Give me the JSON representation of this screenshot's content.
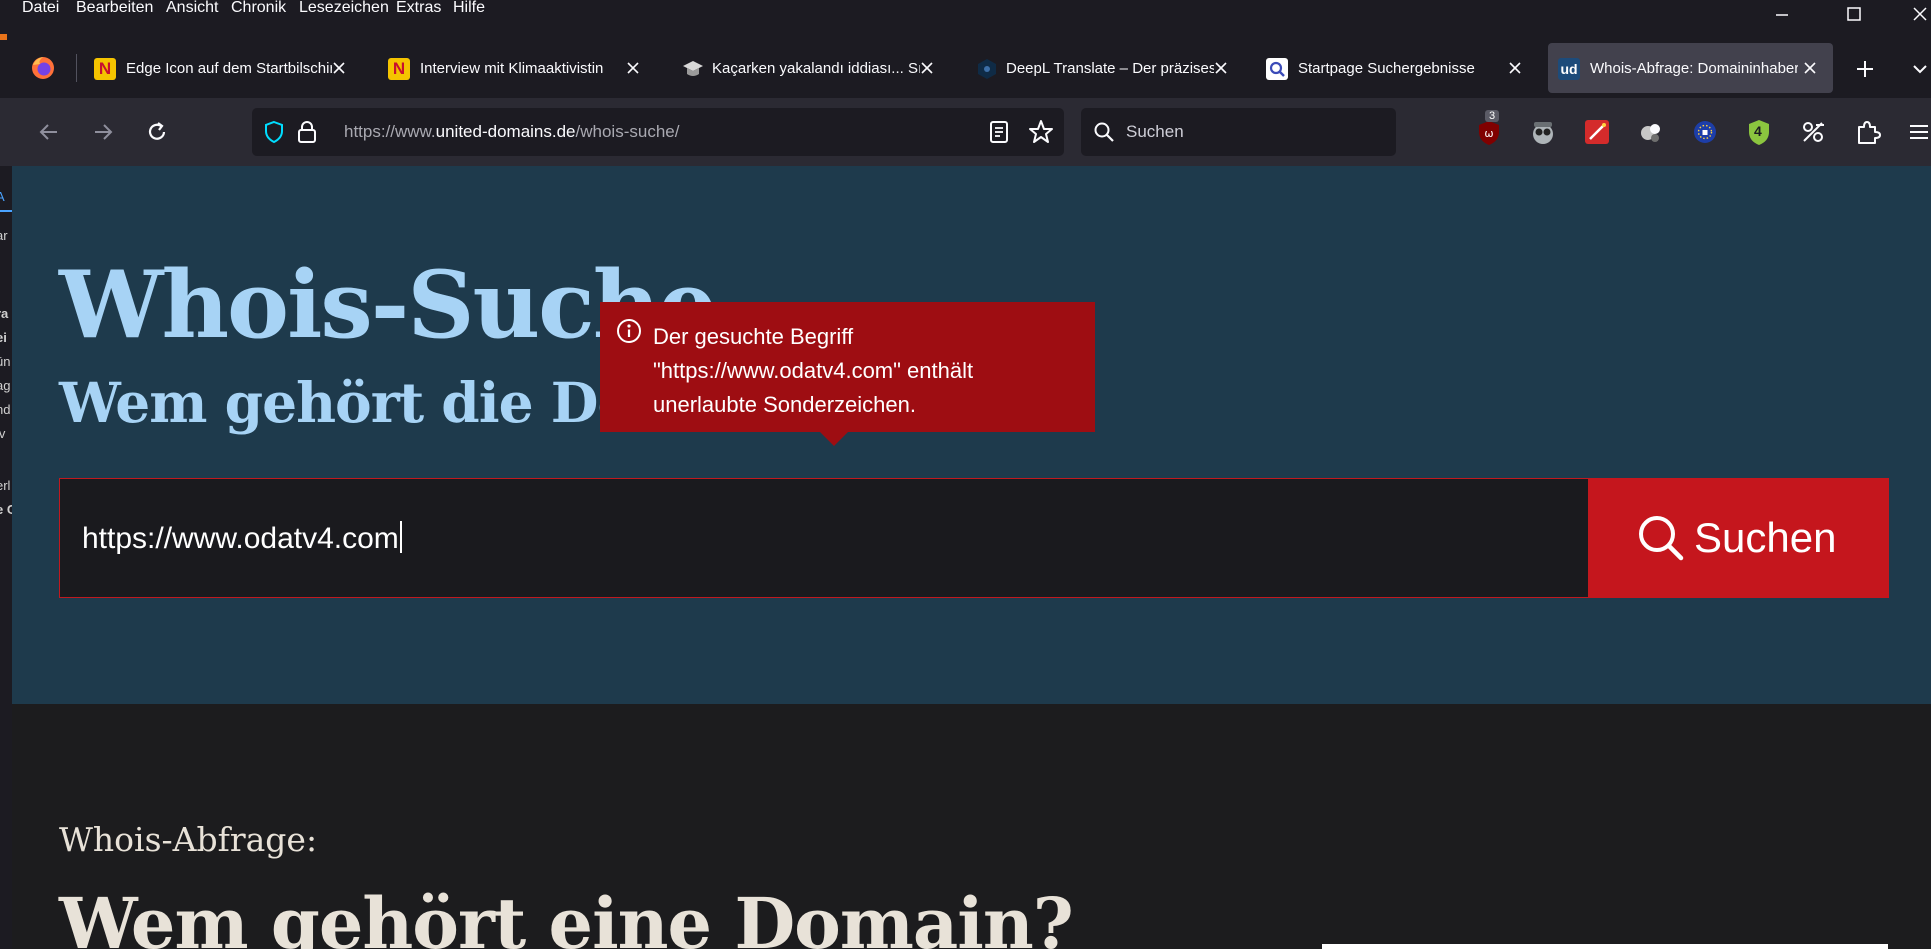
{
  "menubar": {
    "items": [
      "Datei",
      "Bearbeiten",
      "Ansicht",
      "Chronik",
      "Lesezeichen",
      "Extras",
      "Hilfe"
    ]
  },
  "tabs": [
    {
      "title": "Edge Icon auf dem Startbilschirm",
      "favicon": "N",
      "favicon_bg": "#f5c400",
      "favicon_fg": "#c8102e",
      "active": false
    },
    {
      "title": "Interview mit Klimaaktivistin",
      "favicon": "N",
      "favicon_bg": "#f5c400",
      "favicon_fg": "#c8102e",
      "active": false
    },
    {
      "title": "Kaçarken yakalandı iddiası... Sınır",
      "favicon": "graduation-cap-icon",
      "active": false
    },
    {
      "title": "DeepL Translate – Der präziseste",
      "favicon": "deepl-icon",
      "active": false
    },
    {
      "title": "Startpage Suchergebnisse",
      "favicon": "startpage-icon",
      "active": false
    },
    {
      "title": "Whois-Abfrage: Domaininhaber",
      "favicon": "ud",
      "favicon_bg": "#1d4b7a",
      "favicon_fg": "#ffffff",
      "active": true
    }
  ],
  "navbar": {
    "url_prefix": "https://www.",
    "url_host": "united-domains.de",
    "url_path": "/whois-suche/",
    "search_placeholder": "Suchen",
    "ublock_badge": "3",
    "ext_badge_count": "4"
  },
  "left_strip": {
    "fragments": [
      "A",
      "ar",
      "ra",
      "ei",
      "ün",
      "ag",
      "nd",
      "iv",
      "erl",
      "e C"
    ]
  },
  "hero": {
    "title": "Whois-Suche",
    "subtitle": "Wem gehört die Domain?",
    "input_value": "https://www.odatv4.com",
    "search_button_label": "Suchen"
  },
  "error_tooltip": {
    "message": "Der gesuchte Begriff \"https://www.odatv4.com\" enthält unerlaubte Sonderzeichen."
  },
  "lower": {
    "kicker": "Whois-Abfrage:",
    "title": "Wem gehört eine Domain?"
  },
  "colors": {
    "accent_red": "#c5161d",
    "hero_bg": "#1e3a4c",
    "hero_text": "#a7d3f5",
    "error_bg": "#9e0d12"
  }
}
